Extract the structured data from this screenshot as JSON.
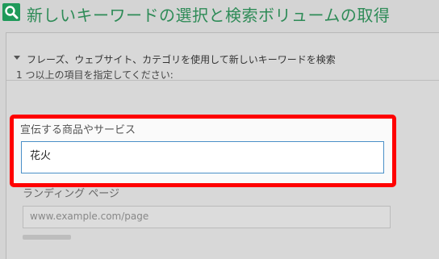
{
  "header": {
    "title": "新しいキーワードの選択と検索ボリュームの取得",
    "icon": "search-icon",
    "accent_color": "#2e8b57"
  },
  "accordion": {
    "label": "フレーズ、ウェブサイト、カテゴリを使用して新しいキーワードを検索",
    "icon": "caret-down-icon",
    "expanded": true
  },
  "form": {
    "instruction": "1 つ以上の項目を指定してください:",
    "product": {
      "label": "宣伝する商品やサービス",
      "value": "花火",
      "highlight_color": "#ff0000"
    },
    "landing_page": {
      "label": "ランディング ページ",
      "placeholder": "www.example.com/page"
    }
  }
}
